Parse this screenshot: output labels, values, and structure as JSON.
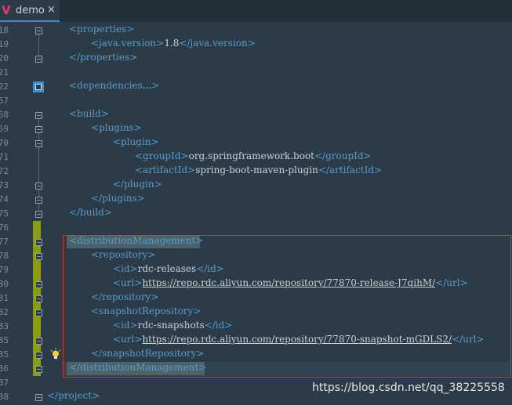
{
  "tab": {
    "logo": "V",
    "name": "demo",
    "close": "×"
  },
  "watermark": "https://blog.csdn.net/qq_38225558",
  "lines": [
    {
      "num": "18",
      "indent": 1,
      "parts": [
        [
          "t",
          "<properties>"
        ]
      ]
    },
    {
      "num": "19",
      "indent": 2,
      "parts": [
        [
          "t",
          "<java.version>"
        ],
        [
          "x",
          "1.8"
        ],
        [
          "t",
          "</java.version>"
        ]
      ]
    },
    {
      "num": "20",
      "indent": 1,
      "parts": [
        [
          "t",
          "</properties>"
        ]
      ]
    },
    {
      "num": "21",
      "indent": 0,
      "parts": []
    },
    {
      "num": "22",
      "indent": 1,
      "parts": [
        [
          "t",
          "<dependencies"
        ],
        [
          "x",
          "..."
        ],
        [
          "t",
          ">"
        ]
      ]
    },
    {
      "num": "67",
      "indent": 0,
      "parts": []
    },
    {
      "num": "68",
      "indent": 1,
      "parts": [
        [
          "t",
          "<build>"
        ]
      ]
    },
    {
      "num": "69",
      "indent": 2,
      "parts": [
        [
          "t",
          "<plugins>"
        ]
      ]
    },
    {
      "num": "70",
      "indent": 3,
      "parts": [
        [
          "t",
          "<plugin>"
        ]
      ]
    },
    {
      "num": "71",
      "indent": 4,
      "parts": [
        [
          "t",
          "<groupId>"
        ],
        [
          "x",
          "org.springframework.boot"
        ],
        [
          "t",
          "</groupId>"
        ]
      ]
    },
    {
      "num": "72",
      "indent": 4,
      "parts": [
        [
          "t",
          "<artifactId>"
        ],
        [
          "x",
          "spring-boot-maven-plugin"
        ],
        [
          "t",
          "</artifactId>"
        ]
      ]
    },
    {
      "num": "73",
      "indent": 3,
      "parts": [
        [
          "t",
          "</plugin>"
        ]
      ]
    },
    {
      "num": "74",
      "indent": 2,
      "parts": [
        [
          "t",
          "</plugins>"
        ]
      ]
    },
    {
      "num": "75",
      "indent": 1,
      "parts": [
        [
          "t",
          "</build>"
        ]
      ]
    },
    {
      "num": "76",
      "indent": 0,
      "parts": []
    },
    {
      "num": "77",
      "indent": 1,
      "parts": [
        [
          "t",
          "<distributionManagement>"
        ]
      ]
    },
    {
      "num": "78",
      "indent": 2,
      "parts": [
        [
          "t",
          "<repository>"
        ]
      ]
    },
    {
      "num": "79",
      "indent": 3,
      "parts": [
        [
          "t",
          "<id>"
        ],
        [
          "x",
          "rdc-releases"
        ],
        [
          "t",
          "</id>"
        ]
      ]
    },
    {
      "num": "80",
      "indent": 3,
      "parts": [
        [
          "t",
          "<url>"
        ],
        [
          "u",
          "https://repo.rdc.aliyun.com/repository/77870-release-J7qihM/"
        ],
        [
          "t",
          "</url>"
        ]
      ]
    },
    {
      "num": "81",
      "indent": 2,
      "parts": [
        [
          "t",
          "</repository>"
        ]
      ]
    },
    {
      "num": "82",
      "indent": 2,
      "parts": [
        [
          "t",
          "<snapshotRepository>"
        ]
      ]
    },
    {
      "num": "83",
      "indent": 3,
      "parts": [
        [
          "t",
          "<id>"
        ],
        [
          "x",
          "rdc-snapshots"
        ],
        [
          "t",
          "</id>"
        ]
      ]
    },
    {
      "num": "85",
      "indent": 3,
      "parts": [
        [
          "t",
          "<url>"
        ],
        [
          "u",
          "https://repo.rdc.aliyun.com/repository/77870-snapshot-mGDLS2/"
        ],
        [
          "t",
          "</url>"
        ]
      ]
    },
    {
      "num": "85",
      "indent": 2,
      "parts": [
        [
          "t",
          "</snapshotRepository>"
        ]
      ]
    },
    {
      "num": "86",
      "indent": 1,
      "parts": [
        [
          "t",
          "</distributionManagement>"
        ]
      ]
    },
    {
      "num": "87",
      "indent": 0,
      "parts": []
    },
    {
      "num": "88",
      "indent": 0,
      "parts": [
        [
          "t",
          "</project>"
        ]
      ]
    }
  ]
}
